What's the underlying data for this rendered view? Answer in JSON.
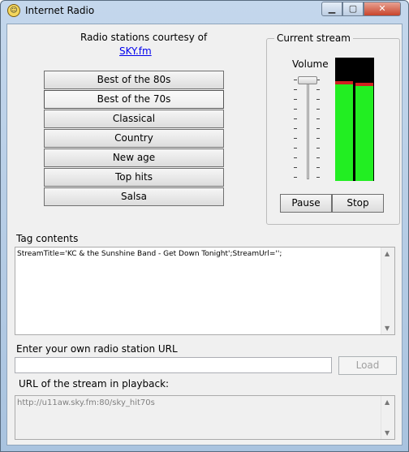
{
  "window": {
    "title": "Internet Radio",
    "controls": {
      "minimize": "▁",
      "maximize": "▢",
      "close": "✕"
    }
  },
  "credits": {
    "text": "Radio stations courtesy of",
    "link": "SKY.fm"
  },
  "stations": [
    {
      "label": "Best of the 80s"
    },
    {
      "label": "Best of the 70s"
    },
    {
      "label": "Classical"
    },
    {
      "label": "Country"
    },
    {
      "label": "New age"
    },
    {
      "label": "Top hits"
    },
    {
      "label": "Salsa"
    }
  ],
  "current_stream": {
    "title": "Current stream",
    "volume_label": "Volume",
    "volume_level": 1.0,
    "left_level": 0.78,
    "right_level": 0.77,
    "pause_label": "Pause",
    "stop_label": "Stop"
  },
  "tag": {
    "label": "Tag contents",
    "value": "StreamTitle='KC & the Sunshine Band - Get Down Tonight';StreamUrl='';"
  },
  "custom_url": {
    "label": "Enter your own radio station URL",
    "value": "",
    "load_label": "Load"
  },
  "playback": {
    "label": "URL of the stream in playback:",
    "value": "http://u11aw.sky.fm:80/sky_hit70s"
  },
  "colors": {
    "meter": "#22ee22",
    "peak": "#d02020",
    "link": "#0000ee"
  }
}
